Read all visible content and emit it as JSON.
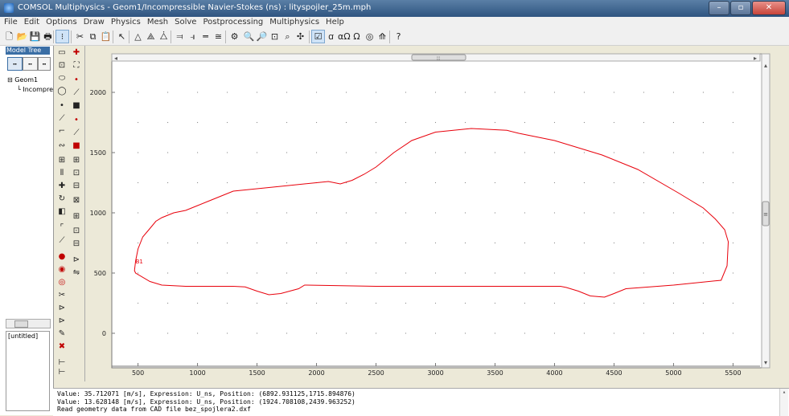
{
  "window": {
    "title": "COMSOL Multiphysics - Geom1/Incompressible Navier-Stokes (ns) : lityspojler_25m.mph",
    "min_label": "–",
    "max_label": "▫",
    "close_label": "✕"
  },
  "menu": [
    "File",
    "Edit",
    "Options",
    "Draw",
    "Physics",
    "Mesh",
    "Solve",
    "Postprocessing",
    "Multiphysics",
    "Help"
  ],
  "toolbar": {
    "icons": [
      "new-file-icon",
      "open-folder-icon",
      "save-icon",
      "print-icon",
      "geometry-mode-icon",
      "cut-icon",
      "copy-icon",
      "paste-icon",
      "pointer-icon",
      "mesh-triangle-icon",
      "refine-mesh-icon",
      "mesh-quad-icon",
      "subdomain-settings-icon",
      "boundary-settings-icon",
      "edge-settings-icon",
      "point-settings-icon",
      "solve-icon",
      "zoom-in-icon",
      "zoom-out-icon",
      "zoom-window-icon",
      "zoom-extents-icon",
      "restart-icon",
      "suggestions-icon",
      "constants-icon",
      "expressions-icon",
      "omega-icon",
      "scalar-icon",
      "plot-icon",
      "help-icon"
    ],
    "glyphs": [
      "🗋",
      "📂",
      "💾",
      "🖶",
      "⁝",
      "✂",
      "⧉",
      "📋",
      "↖",
      "△",
      "⟁",
      "⧊",
      "⫤",
      "⫣",
      "═",
      "≅",
      "⚙",
      "🔍",
      "🔎",
      "⊡",
      "⌕",
      "✣",
      "☑",
      "ꭤ",
      "αΩ",
      "Ω",
      "◎",
      "⟰",
      "?"
    ]
  },
  "model_tree": {
    "header": "Model Tree",
    "buttons": [
      "⬝⬝",
      "⬝⬝",
      "⬝⬝"
    ],
    "root": "⊟ Geom1",
    "child": "└ Incompre"
  },
  "untitled_label": "[untitled]",
  "draw_icons_left": [
    "rectangle-icon",
    "square-icon",
    "ellipse-icon",
    "circle-icon",
    "point-icon",
    "line-icon",
    "curve-icon",
    "bezier-icon",
    "array-icon",
    "mirror-icon",
    "move-icon",
    "rotate-icon",
    "scale-icon",
    "fillet-icon",
    "tangent-icon",
    "union-icon",
    "intersect-icon",
    "difference-icon",
    "split-icon",
    "coerce-solid-icon",
    "coerce-face-icon",
    "paint-icon",
    "delete-icon",
    "create-pairs-icon",
    "use-assembly-icon"
  ],
  "draw_glyphs_left": [
    "▭",
    "⊡",
    "⬭",
    "◯",
    "•",
    "⟋",
    "⌐",
    "∾",
    "⊞",
    "⫴",
    "✚",
    "↻",
    "◧",
    "⌜",
    "⟋",
    "●",
    "◉",
    "◎",
    "✂",
    "⊳",
    "⊳",
    "✎",
    "✖",
    "⊢",
    "⊢"
  ],
  "draw_icons_right": [
    "draw-mode-icon",
    "point-mode-icon",
    "point-2-icon",
    "segment-icon",
    "square-solid-icon",
    "arc-icon",
    "line-2-icon",
    "solid-red-icon",
    "array-2-icon",
    "copy-2-icon",
    "extrude-icon",
    "revolve-icon",
    "embed-icon",
    "work-plane-icon",
    "export-icon",
    "import-icon",
    "assembly-icon"
  ],
  "draw_glyphs_right": [
    "✚",
    "⛶",
    "•",
    "⟋",
    "■",
    "•",
    "⟋",
    "■",
    "⊞",
    "⊡",
    "⊟",
    "⊠",
    "⊞",
    "⊡",
    "⊟",
    "⊳",
    "⇋"
  ],
  "chart_data": {
    "type": "line",
    "xlabel": "",
    "ylabel": "",
    "xlim": [
      300,
      5700
    ],
    "ylim": [
      -220,
      2240
    ],
    "x_ticks": [
      500,
      1000,
      1500,
      2000,
      2500,
      3000,
      3500,
      4000,
      4500,
      5000,
      5500
    ],
    "y_ticks": [
      0,
      500,
      1000,
      1500,
      2000
    ],
    "grid": "dots",
    "annotations": [
      {
        "text": "B1",
        "x": 500,
        "y": 600
      }
    ],
    "series": [
      {
        "color": "#e8000b",
        "x": [
          480,
          470,
          480,
          600,
          700,
          900,
          1050,
          1300,
          1400,
          1500,
          1600,
          1700,
          1850,
          1900,
          2500,
          3000,
          3500,
          4050,
          4100,
          4200,
          4300,
          4420,
          4500,
          4600,
          5000,
          5100,
          5400,
          5450,
          5460,
          5430,
          5350,
          5250,
          5150,
          5050,
          4700,
          4400,
          4000,
          3700,
          3600,
          3300,
          3000,
          2800,
          2650,
          2500,
          2400,
          2300,
          2200,
          2100,
          2000,
          1800,
          1500,
          1300,
          1200,
          1100,
          1000,
          900,
          800,
          700,
          650,
          600,
          540,
          500,
          480
        ],
        "y": [
          600,
          520,
          500,
          430,
          400,
          390,
          390,
          390,
          385,
          350,
          320,
          330,
          370,
          400,
          390,
          390,
          390,
          390,
          380,
          350,
          310,
          300,
          330,
          370,
          400,
          410,
          440,
          560,
          760,
          860,
          950,
          1040,
          1100,
          1160,
          1360,
          1480,
          1600,
          1660,
          1685,
          1700,
          1670,
          1600,
          1500,
          1380,
          1320,
          1270,
          1240,
          1260,
          1250,
          1230,
          1200,
          1180,
          1140,
          1100,
          1060,
          1020,
          1000,
          960,
          930,
          870,
          800,
          700,
          600
        ]
      }
    ]
  },
  "scrollbars": {
    "h_arrow_left": "◂",
    "h_arrow_right": "▸",
    "h_grip": "⦙⦙⦙",
    "v_arrow_up": "▴",
    "v_arrow_down": "▾",
    "v_grip": "≡"
  },
  "status": {
    "line1": "Value: 35.712071 [m/s], Expression: U_ns, Position: (6892.931125,1715.894876)",
    "line2": "Value: 13.628148 [m/s], Expression: U_ns, Position: (1924.708108,2439.963252)",
    "line3": "Read geometry data from CAD file bez_spojlera2.dxf"
  }
}
